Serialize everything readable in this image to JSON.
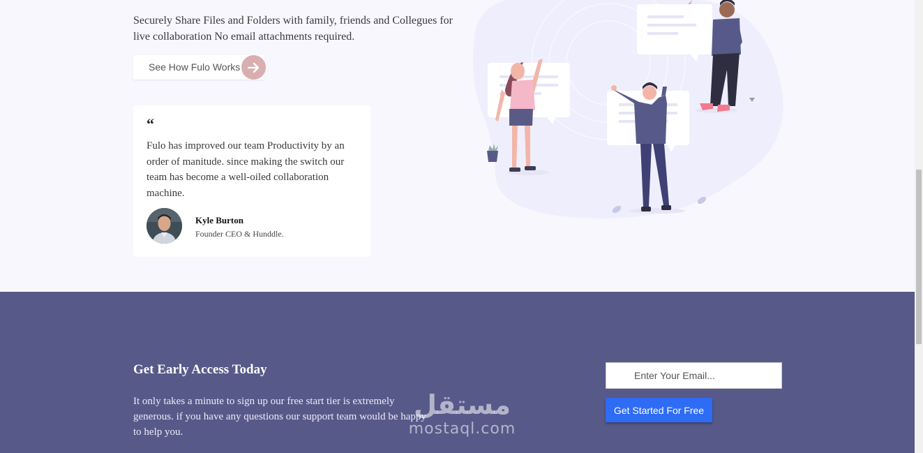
{
  "hero": {
    "intro": "Securely Share Files and Folders with family, friends and Collegues for live collaboration No email attachments required.",
    "cta_label": "See How Fulo Works",
    "cta_icon": "arrow-right-icon"
  },
  "testimonial": {
    "quote_mark": "“",
    "text": "Fulo has improved our team Productivity by an order of manitude. since making the switch our team has become a well-oiled collaboration machine.",
    "author_name": "Kyle Burton",
    "author_role": "Founder CEO & Hunddle."
  },
  "illustration": {
    "subject": "people-collaborating-illustration"
  },
  "early_access": {
    "title": "Get Early Access Today",
    "description": "It only takes a minute to sign up our free start tier is extremely generous. if you have any questions our support team would be happy to help you.",
    "email_placeholder": "Enter Your Email...",
    "button_label": "Get Started For Free"
  },
  "watermark": {
    "arabic": "مستقل",
    "latin": "mostaql.com"
  },
  "colors": {
    "page_bg": "#f8f7fe",
    "footer_bg": "#575a89",
    "cta_arrow": "#d9aeb0",
    "primary_button": "#2f6cf6"
  }
}
